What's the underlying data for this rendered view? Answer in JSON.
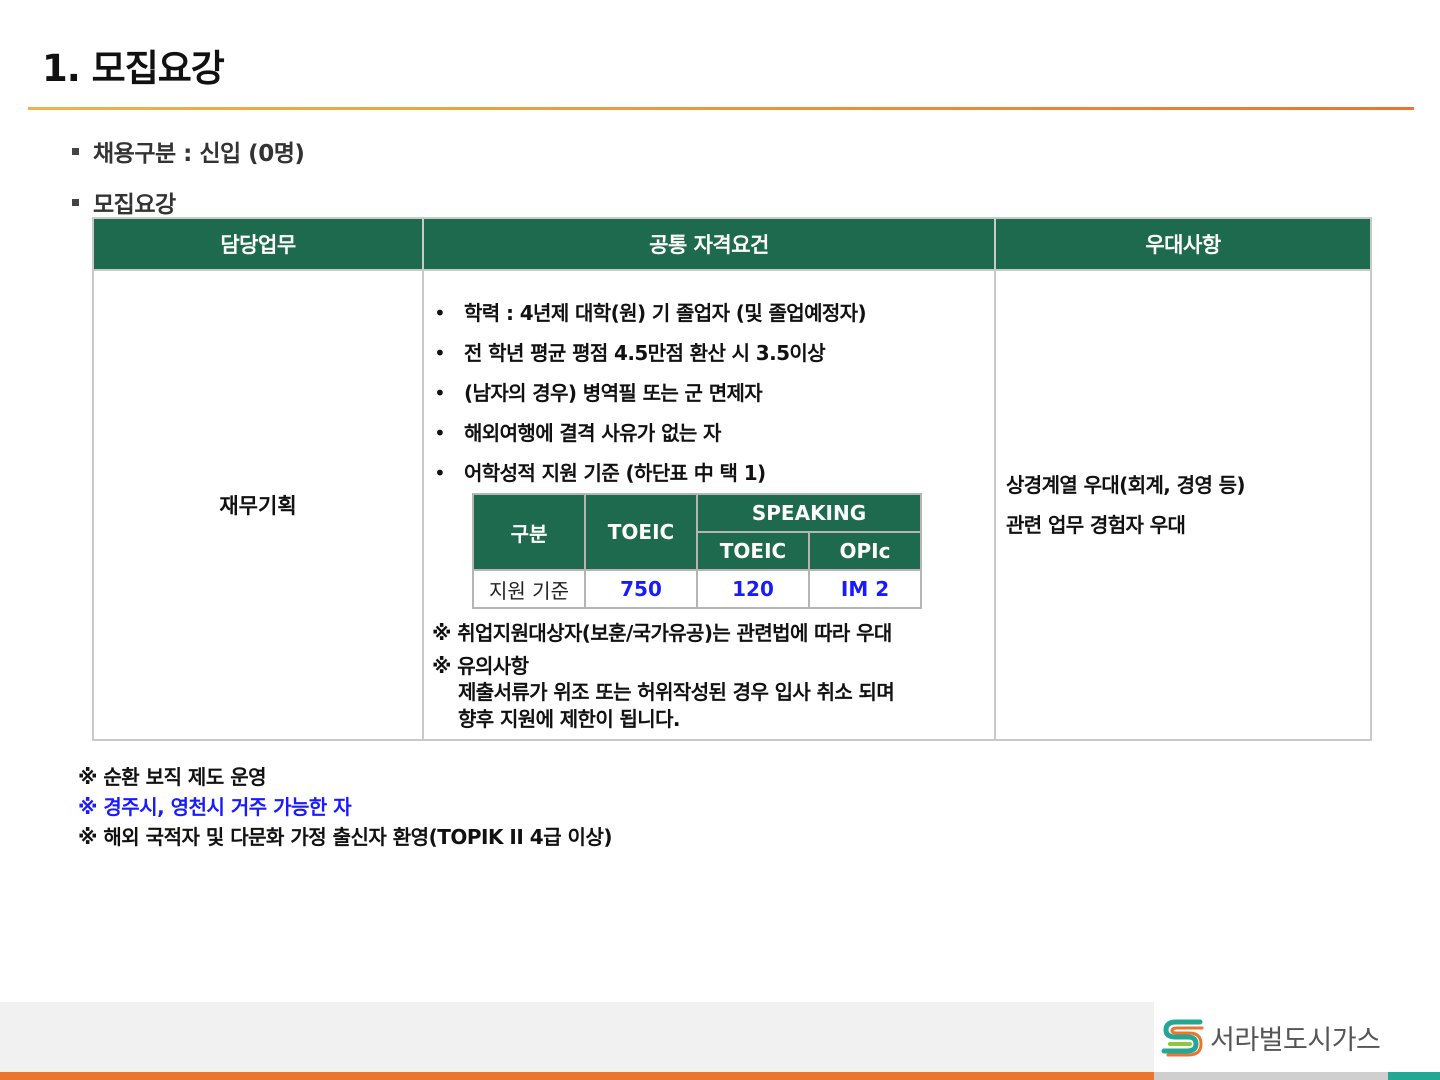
{
  "page": {
    "title": "1. 모집요강"
  },
  "sections": {
    "hire_type": "채용구분 : 신입 (0명)",
    "requirements_heading": "모집요강"
  },
  "table": {
    "headers": [
      "담당업무",
      "공통 자격요건",
      "우대사항"
    ],
    "duty": "재무기획",
    "qualifications": [
      "학력 : 4년제 대학(원) 기 졸업자 (및 졸업예정자)",
      "전 학년 평균 평점 4.5만점 환산 시 3.5이상",
      "(남자의 경우) 병역필 또는 군 면제자",
      "해외여행에 결격 사유가 없는 자",
      "어학성적 지원 기준 (하단표 中 택 1)"
    ],
    "score_table": {
      "col_category": "구분",
      "col_toeic": "TOEIC",
      "col_speaking": "SPEAKING",
      "col_speaking_toeic": "TOEIC",
      "col_speaking_opic": "OPIc",
      "row_label": "지원 기준",
      "toeic_value": "750",
      "speaking_toeic_value": "120",
      "opic_value": "IM 2"
    },
    "notes": {
      "veteran": "※ 취업지원대상자(보훈/국가유공)는 관련법에 따라 우대",
      "caution_title": "※ 유의사항",
      "caution_line1": "제출서류가 위조 또는 허위작성된 경우 입사 취소 되며",
      "caution_line2": "향후 지원에 제한이 됩니다."
    },
    "preferences": [
      "상경계열 우대(회계, 경영 등)",
      "관련 업무 경험자 우대"
    ]
  },
  "footnotes": [
    "※ 순환 보직 제도 운영",
    "※ 경주시, 영천시 거주 가능한 자",
    "※ 해외 국적자 및 다문화 가정 출신자 환영(TOPIK II  4급 이상)"
  ],
  "footer": {
    "company": "서라벌도시가스"
  },
  "colors": {
    "header_green": "#1d6a4f",
    "accent_orange": "#e9752f",
    "accent_teal": "#23a795",
    "highlight_blue": "#1a1aff"
  }
}
